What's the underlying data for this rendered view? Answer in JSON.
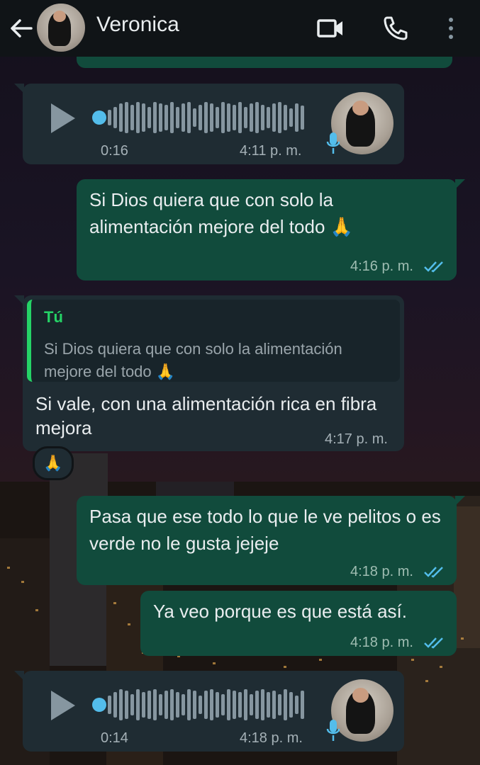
{
  "header": {
    "contact_name": "Veronica",
    "icons": [
      "back-arrow-icon",
      "video-call-icon",
      "phone-icon",
      "more-options-icon"
    ]
  },
  "messages": [
    {
      "type": "voice",
      "direction": "incoming",
      "duration": "0:16",
      "time": "4:11 p. m."
    },
    {
      "type": "text",
      "direction": "outgoing",
      "text": "Si Dios quiera que con solo la alimentación mejore del todo 🙏",
      "time": "4:16 p. m.",
      "status": "read"
    },
    {
      "type": "reply",
      "direction": "incoming",
      "quoted_author": "Tú",
      "quoted_text": "Si Dios quiera que con solo la alimentación mejore del todo 🙏",
      "text": "Si vale, con una alimentación rica en fibra mejora",
      "time": "4:17 p. m.",
      "reaction": "🙏"
    },
    {
      "type": "text",
      "direction": "outgoing",
      "text": "Pasa que ese todo lo que le ve pelitos o es verde no le gusta jejeje",
      "time": "4:18 p. m.",
      "status": "read"
    },
    {
      "type": "text",
      "direction": "outgoing",
      "text": "Ya veo porque es que está así.",
      "time": "4:18 p. m.",
      "status": "read"
    },
    {
      "type": "voice",
      "direction": "incoming",
      "duration": "0:14",
      "time": "4:18 p. m."
    }
  ],
  "colors": {
    "header_bg": "#101417",
    "incoming_bubble": "#1f2c33",
    "outgoing_bubble": "#114b3c",
    "read_ticks": "#53bdeb",
    "quote_accent": "#25d366"
  }
}
